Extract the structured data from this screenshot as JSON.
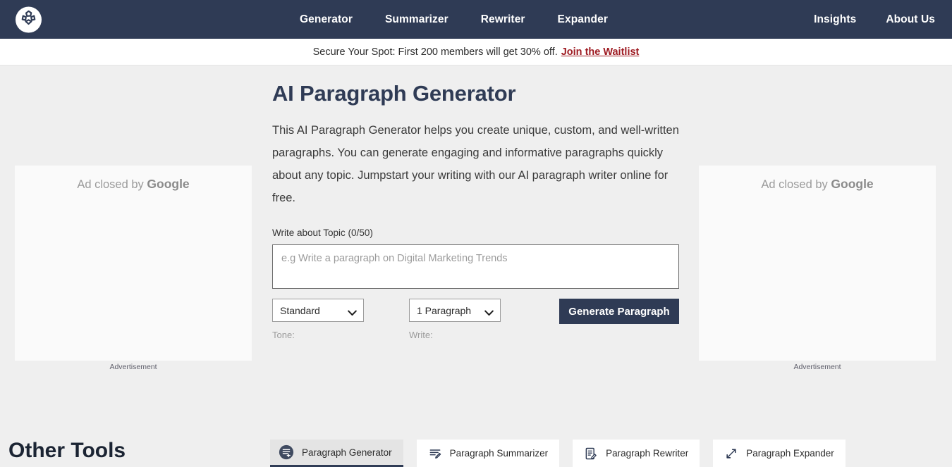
{
  "navbar": {
    "logo_icon": "pinwheel-logo-icon",
    "center_links": [
      {
        "label": "Generator"
      },
      {
        "label": "Summarizer"
      },
      {
        "label": "Rewriter"
      },
      {
        "label": "Expander"
      }
    ],
    "right_links": [
      {
        "label": "Insights"
      },
      {
        "label": "About Us"
      }
    ],
    "background_color": "#2f3b55"
  },
  "announcement": {
    "text": "Secure Your Spot: First 200 members will get 30% off.",
    "link_label": "Join the Waitlist",
    "link_color": "#9e1b22"
  },
  "ads": {
    "left": {
      "closed_prefix": "Ad closed by ",
      "closed_brand": "Google",
      "label": "Advertisement"
    },
    "right": {
      "closed_prefix": "Ad closed by ",
      "closed_brand": "Google",
      "label": "Advertisement"
    }
  },
  "main": {
    "heading": "AI Paragraph Generator",
    "description": "This AI Paragraph Generator helps you create unique, custom, and well-written paragraphs. You can generate engaging and informative paragraphs quickly about any topic. Jumpstart your writing with our AI paragraph writer online for free.",
    "topic_label": "Write about Topic (0/50)",
    "topic_value": "",
    "topic_placeholder": "e.g Write a paragraph on Digital Marketing Trends",
    "tone_selected": "Standard",
    "tone_options": [
      "Standard"
    ],
    "tone_sub_label": "Tone:",
    "write_selected": "1 Paragraph",
    "write_options": [
      "1 Paragraph"
    ],
    "write_sub_label": "Write:",
    "generate_label": "Generate Paragraph",
    "generate_color": "#2f3b55"
  },
  "other_tools": {
    "title": "Other Tools",
    "tabs": [
      {
        "label": "Paragraph Generator",
        "icon": "paragraph-add-icon",
        "active": true
      },
      {
        "label": "Paragraph Summarizer",
        "icon": "summarize-lines-icon",
        "active": false
      },
      {
        "label": "Paragraph Rewriter",
        "icon": "document-pencil-icon",
        "active": false
      },
      {
        "label": "Paragraph Expander",
        "icon": "expand-arrows-icon",
        "active": false
      }
    ]
  }
}
